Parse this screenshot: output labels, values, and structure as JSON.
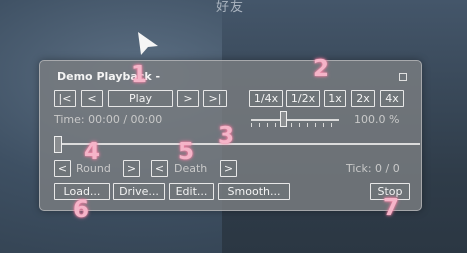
{
  "background": {
    "top_text": "好友"
  },
  "panel": {
    "title": "Demo Playback -",
    "transport": {
      "skip_start": "|<",
      "prev": "<",
      "play": "Play",
      "next": ">",
      "skip_end": ">|"
    },
    "speeds": [
      "1/4x",
      "1/2x",
      "1x",
      "2x",
      "4x"
    ],
    "time": "Time: 00:00 / 00:00",
    "speed_percent": "100.0 %",
    "seek_progress": 0,
    "speed_value": 1.0,
    "round": {
      "prev": "<",
      "label": "Round",
      "next": ">"
    },
    "death": {
      "prev": "<",
      "label": "Death",
      "next": ">"
    },
    "tick": "Tick: 0 / 0",
    "actions": {
      "load": "Load...",
      "drive": "Drive...",
      "edit": "Edit...",
      "smooth": "Smooth...",
      "stop": "Stop"
    }
  },
  "badges": [
    "1",
    "2",
    "3",
    "4",
    "5",
    "6",
    "7"
  ],
  "colors": {
    "badge": "#f5b4c8",
    "panel": "#787c80"
  }
}
